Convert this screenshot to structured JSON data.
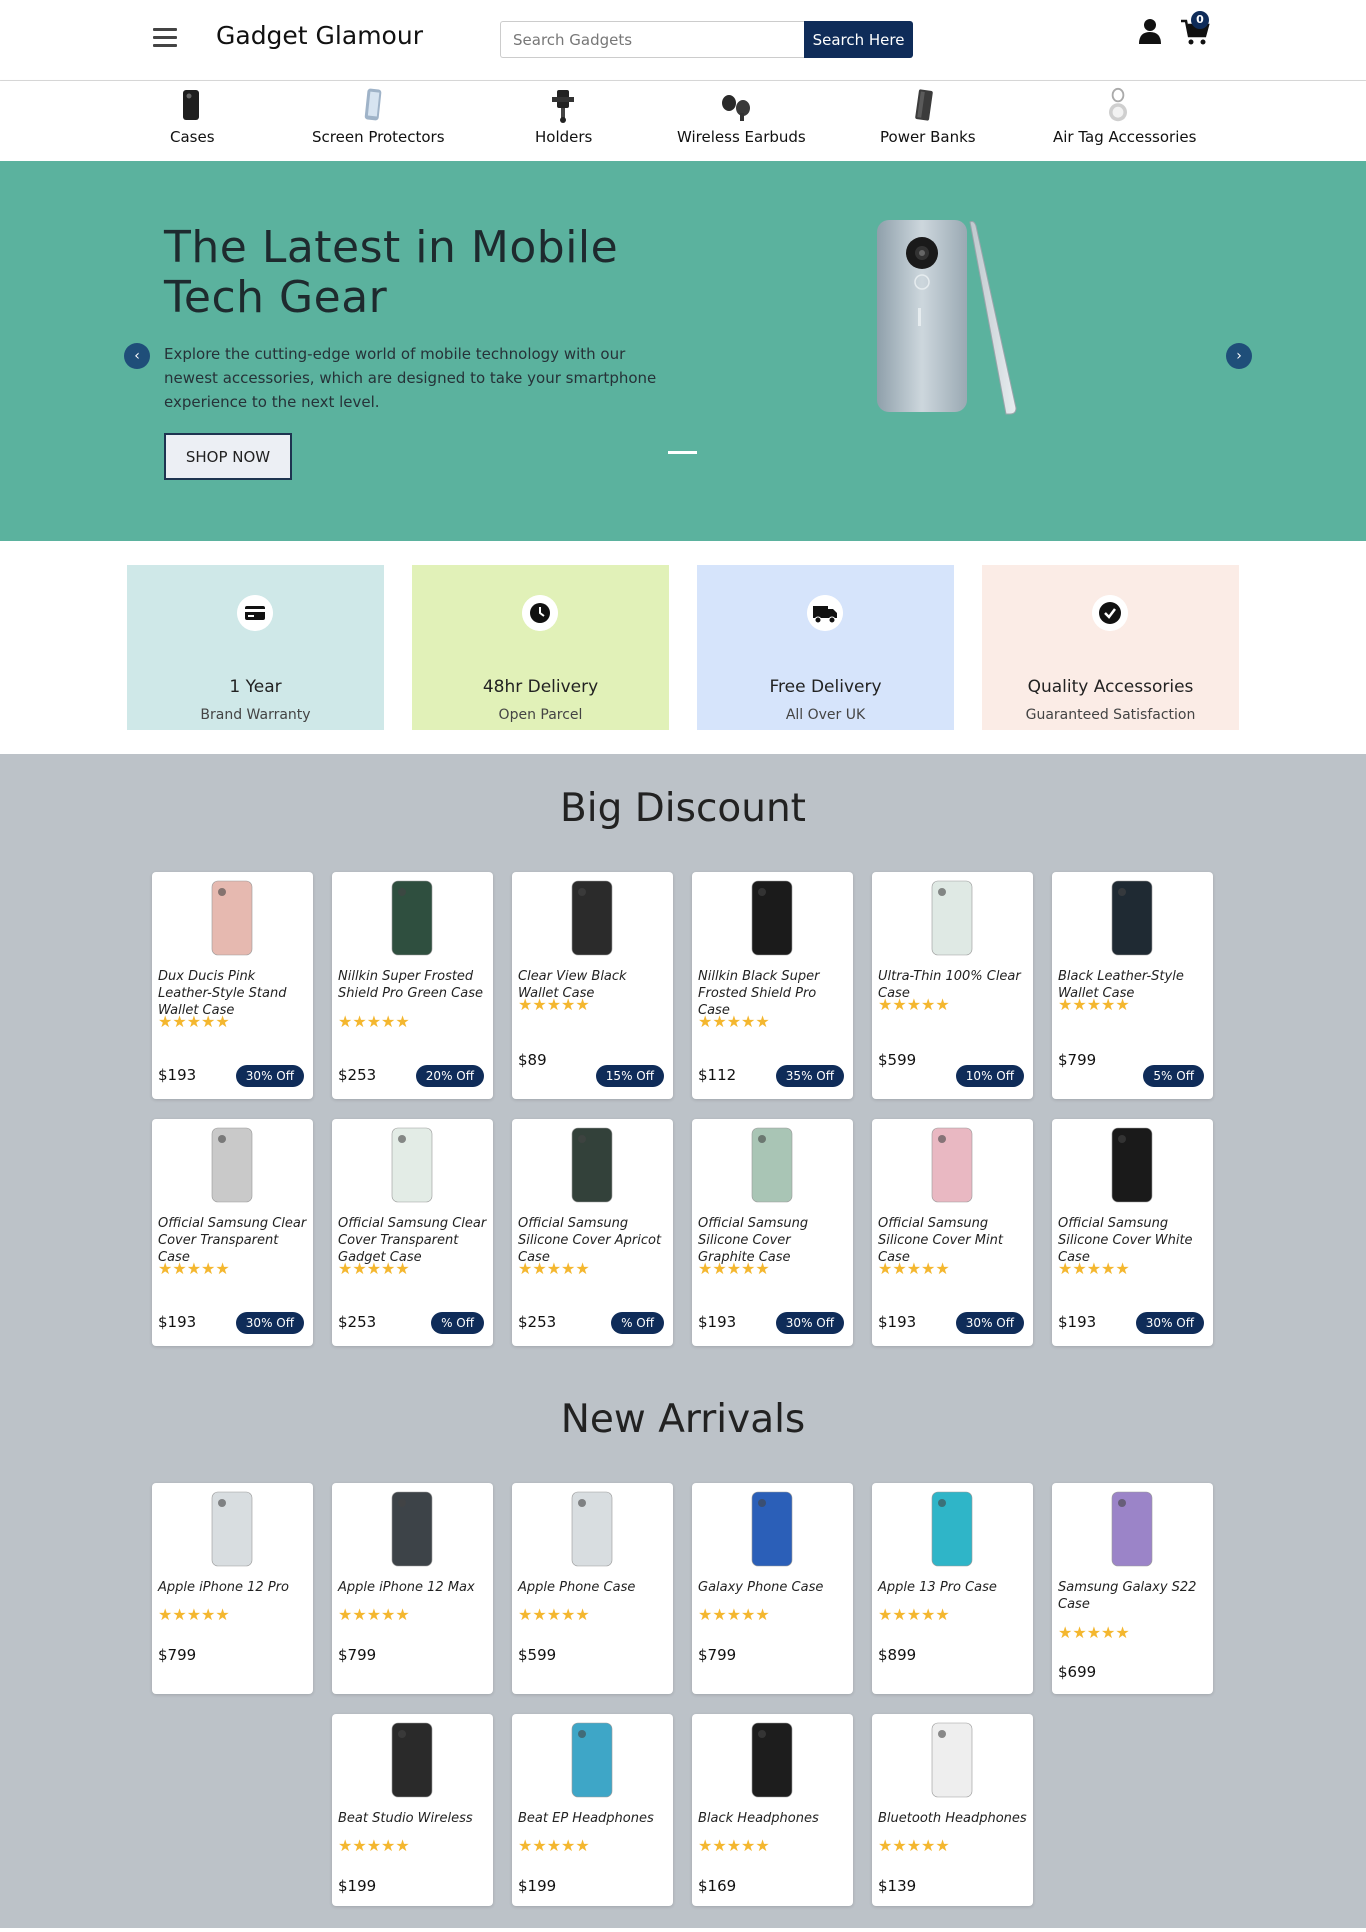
{
  "header": {
    "brand": "Gadget Glamour",
    "search_placeholder": "Search Gadgets",
    "search_button": "Search Here",
    "cart_count": "0"
  },
  "categories": [
    {
      "label": "Cases",
      "icon": "phone-case-icon"
    },
    {
      "label": "Screen Protectors",
      "icon": "screen-protector-icon"
    },
    {
      "label": "Holders",
      "icon": "phone-holder-icon"
    },
    {
      "label": "Wireless Earbuds",
      "icon": "earbuds-icon"
    },
    {
      "label": "Power Banks",
      "icon": "power-bank-icon"
    },
    {
      "label": "Air Tag Accessories",
      "icon": "air-tag-icon"
    }
  ],
  "hero": {
    "title": "The Latest in Mobile Tech Gear",
    "description": "Explore the cutting-edge world of mobile technology with our newest accessories, which are designed to take your smartphone experience to the next level.",
    "button": "SHOP NOW",
    "prev": "‹",
    "next": "›"
  },
  "features": [
    {
      "title": "1 Year",
      "subtitle": "Brand Warranty",
      "icon": "credit-card-icon",
      "bg": "#cfe8e8"
    },
    {
      "title": "48hr Delivery",
      "subtitle": "Open Parcel",
      "icon": "clock-icon",
      "bg": "#e1f1b8"
    },
    {
      "title": "Free Delivery",
      "subtitle": "All Over UK",
      "icon": "truck-icon",
      "bg": "#d6e4fb"
    },
    {
      "title": "Quality Accessories",
      "subtitle": "Guaranteed Satisfaction",
      "icon": "check-circle-icon",
      "bg": "#fbece6"
    }
  ],
  "big_discount": {
    "title": "Big Discount",
    "items": [
      {
        "name": "Dux Ducis Pink Leather-Style Stand Wallet Case",
        "price": "$193",
        "badge": "30% Off",
        "rating": "★★★★★",
        "color": "#e6b9b0"
      },
      {
        "name": "Nillkin Super Frosted Shield Pro Green Case",
        "price": "$253",
        "badge": "20% Off",
        "rating": "★★★★★",
        "color": "#2f4f3f"
      },
      {
        "name": "Clear View Black Wallet Case",
        "price": "$89",
        "badge": "15% Off",
        "rating": "★★★★★",
        "color": "#2b2b2b"
      },
      {
        "name": "Nillkin Black Super Frosted Shield Pro Case",
        "price": "$112",
        "badge": "35% Off",
        "rating": "★★★★★",
        "color": "#1b1b1b"
      },
      {
        "name": "Ultra-Thin 100% Clear Case",
        "price": "$599",
        "badge": "10% Off",
        "rating": "★★★★★",
        "color": "#dfe9e4"
      },
      {
        "name": "Black Leather-Style Wallet Case",
        "price": "$799",
        "badge": "5% Off",
        "rating": "★★★★★",
        "color": "#1f2a33"
      },
      {
        "name": "Official Samsung Clear Cover Transparent Case",
        "price": "$193",
        "badge": "30% Off",
        "rating": "★★★★★",
        "color": "#c9c9c9"
      },
      {
        "name": "Official Samsung Clear Cover Transparent Gadget Case",
        "price": "$253",
        "badge": "% Off",
        "rating": "★★★★★",
        "color": "#e3ece6"
      },
      {
        "name": "Official Samsung Silicone Cover Apricot Case",
        "price": "$253",
        "badge": "% Off",
        "rating": "★★★★★",
        "color": "#33413a"
      },
      {
        "name": "Official Samsung Silicone Cover Graphite Case",
        "price": "$193",
        "badge": "30% Off",
        "rating": "★★★★★",
        "color": "#a9c5b5"
      },
      {
        "name": "Official Samsung Silicone Cover Mint Case",
        "price": "$193",
        "badge": "30% Off",
        "rating": "★★★★★",
        "color": "#e9b8c2"
      },
      {
        "name": "Official Samsung Silicone Cover White Case",
        "price": "$193",
        "badge": "30% Off",
        "rating": "★★★★★",
        "color": "#1a1a1a"
      }
    ]
  },
  "new_arrivals": {
    "title": "New Arrivals",
    "items": [
      {
        "name": "Apple iPhone 12 Pro",
        "price": "$799",
        "rating": "★★★★★",
        "color": "#d8dde0"
      },
      {
        "name": "Apple iPhone 12 Max",
        "price": "$799",
        "rating": "★★★★★",
        "color": "#3d4348"
      },
      {
        "name": "Apple Phone Case",
        "price": "$599",
        "rating": "★★★★★",
        "color": "#d8dde0"
      },
      {
        "name": "Galaxy Phone Case",
        "price": "$799",
        "rating": "★★★★★",
        "color": "#2b5fb8"
      },
      {
        "name": "Apple 13 Pro Case",
        "price": "$899",
        "rating": "★★★★★",
        "color": "#2fb5c8"
      },
      {
        "name": "Samsung Galaxy S22 Case",
        "price": "$699",
        "rating": "★★★★★",
        "color": "#9b84c8"
      },
      {
        "name": "Beat Studio Wireless",
        "price": "$199",
        "rating": "★★★★★",
        "color": "#2a2a2a"
      },
      {
        "name": "Beat EP Headphones",
        "price": "$199",
        "rating": "★★★★★",
        "color": "#3ea6c7"
      },
      {
        "name": "Black Headphones",
        "price": "$169",
        "rating": "★★★★★",
        "color": "#1d1d1d"
      },
      {
        "name": "Bluetooth Headphones",
        "price": "$139",
        "rating": "★★★★★",
        "color": "#eeeeee"
      }
    ]
  }
}
